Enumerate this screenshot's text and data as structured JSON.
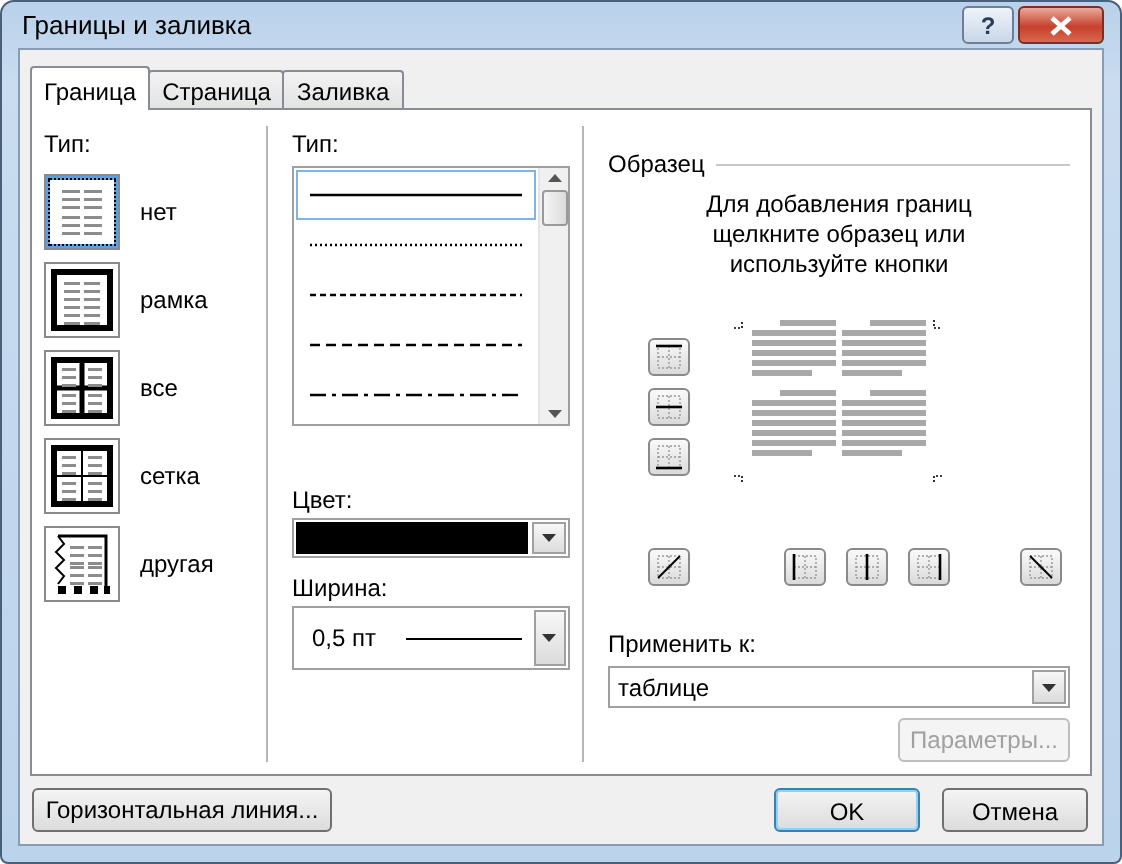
{
  "window": {
    "title": "Границы и заливка",
    "help_button": "?"
  },
  "tabs": [
    {
      "label": "Граница",
      "selected": true
    },
    {
      "label": "Страница",
      "selected": false
    },
    {
      "label": "Заливка",
      "selected": false
    }
  ],
  "setting": {
    "label": "Тип:",
    "presets": [
      {
        "label": "нет",
        "kind": "none",
        "selected": true
      },
      {
        "label": "рамка",
        "kind": "box",
        "selected": false
      },
      {
        "label": "все",
        "kind": "all",
        "selected": false
      },
      {
        "label": "сетка",
        "kind": "grid",
        "selected": false
      },
      {
        "label": "другая",
        "kind": "custom",
        "selected": false
      }
    ]
  },
  "style": {
    "label": "Тип:",
    "lines": [
      {
        "kind": "solid",
        "selected": true
      },
      {
        "kind": "dotted",
        "selected": false
      },
      {
        "kind": "fine-dash",
        "selected": false
      },
      {
        "kind": "dashed",
        "selected": false
      },
      {
        "kind": "dash-dot",
        "selected": false
      }
    ]
  },
  "color": {
    "label": "Цвет:",
    "color": "#000000"
  },
  "width": {
    "label": "Ширина:",
    "value": "0,5 пт"
  },
  "preview": {
    "title": "Образец",
    "hint": "Для добавления границ щелкните образец или используйте кнопки"
  },
  "apply_to": {
    "label": "Применить к:",
    "value": "таблице"
  },
  "options_button": {
    "label": "Параметры...",
    "disabled": true
  },
  "horizontal_line_button": "Горизонтальная линия...",
  "ok_button": "OK",
  "cancel_button": "Отмена"
}
